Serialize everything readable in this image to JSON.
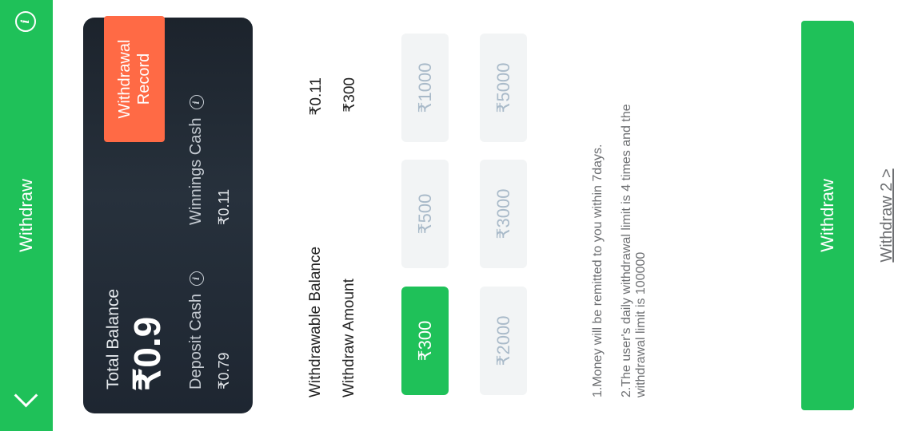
{
  "header": {
    "title": "Withdraw",
    "back_icon": "chevron-left-icon",
    "info_label": "i"
  },
  "balance_card": {
    "total_label": "Total Balance",
    "total_value": "₹0.9",
    "record_button": "Withdrawal Record",
    "deposit_label": "Deposit Cash",
    "deposit_value": "₹0.79",
    "winnings_label": "Winnings Cash",
    "winnings_value": "₹0.11",
    "info_label": "i"
  },
  "withdrawable": {
    "label": "Withdrawable Balance",
    "value": "₹0.11"
  },
  "withdraw_amount": {
    "label": "Withdraw Amount",
    "value": "₹300"
  },
  "amounts": [
    {
      "label": "₹300",
      "selected": true
    },
    {
      "label": "₹500",
      "selected": false
    },
    {
      "label": "₹1000",
      "selected": false
    },
    {
      "label": "₹2000",
      "selected": false
    },
    {
      "label": "₹3000",
      "selected": false
    },
    {
      "label": "₹5000",
      "selected": false
    }
  ],
  "notes": [
    "1.Money will be remitted to you within 7days.",
    "2.The user's daily withdrawal limit is 4 times and the withdrawal limit is 100000"
  ],
  "withdraw_button": "Withdraw",
  "withdraw2_link": "Withdraw 2 >",
  "colors": {
    "accent": "#1fc159",
    "record": "#ff6a45",
    "card": "#1e2631"
  }
}
